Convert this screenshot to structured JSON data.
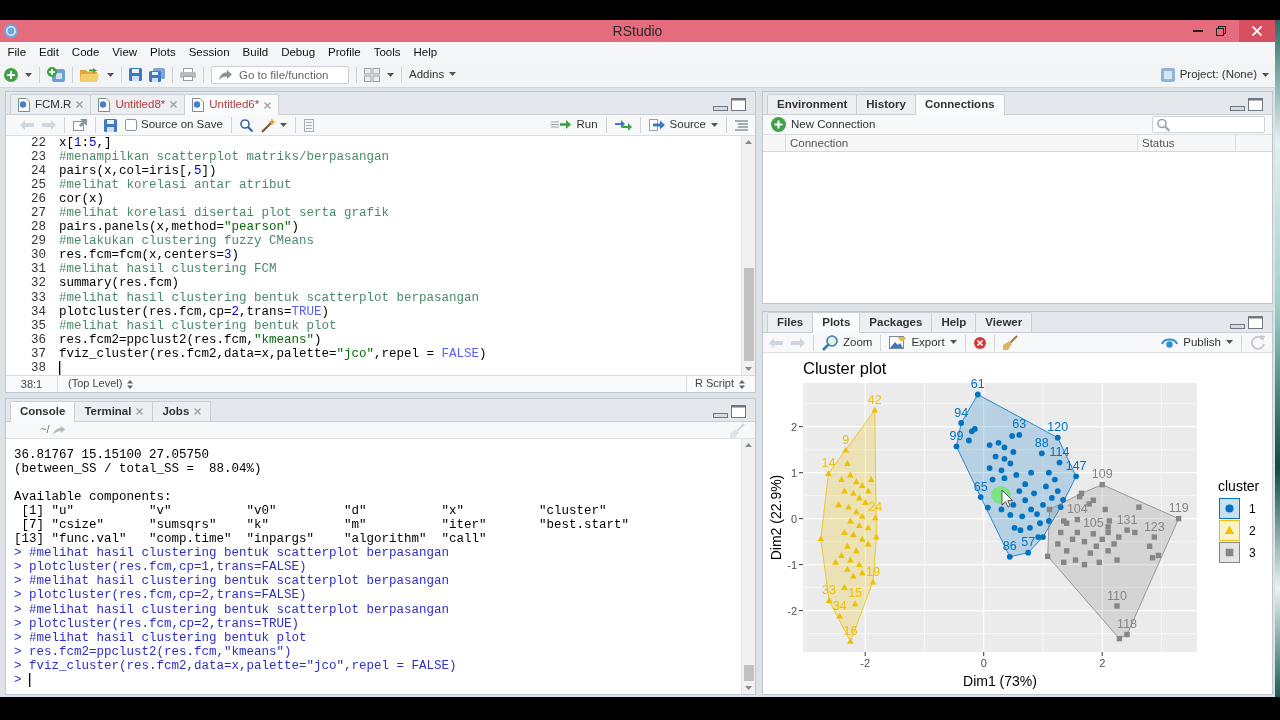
{
  "window": {
    "title": "RStudio"
  },
  "menu": [
    "File",
    "Edit",
    "Code",
    "View",
    "Plots",
    "Session",
    "Build",
    "Debug",
    "Profile",
    "Tools",
    "Help"
  ],
  "toolbar": {
    "go_to_placeholder": "Go to file/function",
    "addins": "Addins",
    "project": "Project: (None)"
  },
  "source": {
    "tabs": [
      {
        "label": "FCM.R",
        "modified": false,
        "closable": true,
        "selected": false
      },
      {
        "label": "Untitled8*",
        "modified": true,
        "closable": true,
        "selected": false
      },
      {
        "label": "Untitled6*",
        "modified": true,
        "closable": true,
        "selected": true
      }
    ],
    "history_disabled": true,
    "source_on_save": {
      "label": "Source on Save",
      "checked": false
    },
    "run": "Run",
    "source": "Source",
    "lines": [
      {
        "number": "22",
        "caret": false,
        "tokens": [
          {
            "kind": "plain",
            "text": "x["
          },
          {
            "kind": "number",
            "text": "1"
          },
          {
            "kind": "plain",
            "text": ":"
          },
          {
            "kind": "number",
            "text": "5"
          },
          {
            "kind": "plain",
            "text": ",]"
          }
        ]
      },
      {
        "number": "23",
        "caret": false,
        "tokens": [
          {
            "kind": "comment",
            "text": "#menampilkan scatterplot matriks/berpasangan"
          }
        ]
      },
      {
        "number": "24",
        "caret": false,
        "tokens": [
          {
            "kind": "plain",
            "text": "pairs(x,col=iris[,"
          },
          {
            "kind": "number",
            "text": "5"
          },
          {
            "kind": "plain",
            "text": "])"
          }
        ]
      },
      {
        "number": "25",
        "caret": false,
        "tokens": [
          {
            "kind": "comment",
            "text": "#melihat korelasi antar atribut"
          }
        ]
      },
      {
        "number": "26",
        "caret": false,
        "tokens": [
          {
            "kind": "plain",
            "text": "cor(x)"
          }
        ]
      },
      {
        "number": "27",
        "caret": false,
        "tokens": [
          {
            "kind": "comment",
            "text": "#melihat korelasi disertai plot serta grafik"
          }
        ]
      },
      {
        "number": "28",
        "caret": false,
        "tokens": [
          {
            "kind": "plain",
            "text": "pairs.panels(x,method="
          },
          {
            "kind": "string",
            "text": "\"pearson\""
          },
          {
            "kind": "plain",
            "text": ")"
          }
        ]
      },
      {
        "number": "29",
        "caret": false,
        "tokens": [
          {
            "kind": "comment",
            "text": "#melakukan clustering fuzzy CMeans"
          }
        ]
      },
      {
        "number": "30",
        "caret": false,
        "tokens": [
          {
            "kind": "plain",
            "text": "res.fcm=fcm(x,centers="
          },
          {
            "kind": "number",
            "text": "3"
          },
          {
            "kind": "plain",
            "text": ")"
          }
        ]
      },
      {
        "number": "31",
        "caret": false,
        "tokens": [
          {
            "kind": "comment",
            "text": "#melihat hasil clustering FCM"
          }
        ]
      },
      {
        "number": "32",
        "caret": false,
        "tokens": [
          {
            "kind": "plain",
            "text": "summary(res.fcm)"
          }
        ]
      },
      {
        "number": "33",
        "caret": false,
        "tokens": [
          {
            "kind": "comment",
            "text": "#melihat hasil clustering bentuk scatterplot berpasangan"
          }
        ]
      },
      {
        "number": "34",
        "caret": false,
        "tokens": [
          {
            "kind": "plain",
            "text": "plotcluster(res.fcm,cp="
          },
          {
            "kind": "number",
            "text": "2"
          },
          {
            "kind": "plain",
            "text": ",trans="
          },
          {
            "kind": "constant",
            "text": "TRUE"
          },
          {
            "kind": "plain",
            "text": ")"
          }
        ]
      },
      {
        "number": "35",
        "caret": false,
        "tokens": [
          {
            "kind": "comment",
            "text": "#melihat hasil clustering bentuk plot"
          }
        ]
      },
      {
        "number": "36",
        "caret": false,
        "tokens": [
          {
            "kind": "plain",
            "text": "res.fcm2=ppclust2(res.fcm,"
          },
          {
            "kind": "string",
            "text": "\"kmeans\""
          },
          {
            "kind": "plain",
            "text": ")"
          }
        ]
      },
      {
        "number": "37",
        "caret": false,
        "tokens": [
          {
            "kind": "plain",
            "text": "fviz_cluster(res.fcm2,data=x,palette="
          },
          {
            "kind": "string",
            "text": "\"jco\""
          },
          {
            "kind": "plain",
            "text": ",repel = "
          },
          {
            "kind": "constant",
            "text": "FALSE"
          },
          {
            "kind": "plain",
            "text": ")"
          }
        ]
      },
      {
        "number": "38",
        "caret": true
      }
    ],
    "status": {
      "position": "38:1",
      "scope": "(Top Level)",
      "file_type": "R Script"
    }
  },
  "console": {
    "tabs": [
      {
        "label": "Console",
        "closable": false,
        "selected": true
      },
      {
        "label": "Terminal",
        "closable": true,
        "selected": false
      },
      {
        "label": "Jobs",
        "closable": true,
        "selected": false
      }
    ],
    "path": "~/",
    "lines": [
      {
        "kind": "output",
        "text": "36.81767 15.15100 27.05750"
      },
      {
        "kind": "output",
        "text": "(between_SS / total_SS =  88.04%)"
      },
      {
        "kind": "blank"
      },
      {
        "kind": "output",
        "text": "Available components:"
      },
      {
        "kind": "output",
        "text": " [1] \"u\"          \"v\"          \"v0\"         \"d\"          \"x\"          \"cluster\""
      },
      {
        "kind": "output",
        "text": " [7] \"csize\"      \"sumsqrs\"    \"k\"          \"m\"          \"iter\"       \"best.start\""
      },
      {
        "kind": "output",
        "text": "[13] \"func.val\"   \"comp.time\"  \"inpargs\"    \"algorithm\"  \"call\""
      },
      {
        "kind": "input",
        "text": "> #melihat hasil clustering bentuk scatterplot berpasangan"
      },
      {
        "kind": "input",
        "text": "> plotcluster(res.fcm,cp=1,trans=FALSE)"
      },
      {
        "kind": "input",
        "text": "> #melihat hasil clustering bentuk scatterplot berpasangan"
      },
      {
        "kind": "input",
        "text": "> plotcluster(res.fcm,cp=2,trans=FALSE)"
      },
      {
        "kind": "input",
        "text": "> #melihat hasil clustering bentuk scatterplot berpasangan"
      },
      {
        "kind": "input",
        "text": "> plotcluster(res.fcm,cp=2,trans=TRUE)"
      },
      {
        "kind": "input",
        "text": "> #melihat hasil clustering bentuk plot"
      },
      {
        "kind": "input",
        "text": "> res.fcm2=ppclust2(res.fcm,\"kmeans\")"
      },
      {
        "kind": "input",
        "text": "> fviz_cluster(res.fcm2,data=x,palette=\"jco\",repel = FALSE)"
      }
    ],
    "prompt": {
      "text": ">",
      "caret": true
    }
  },
  "environment": {
    "tabs": [
      {
        "label": "Environment",
        "selected": false
      },
      {
        "label": "History",
        "selected": false
      },
      {
        "label": "Connections",
        "selected": true
      }
    ],
    "new_connection": "New Connection",
    "columns": [
      "Connection",
      "Status"
    ]
  },
  "plots": {
    "tabs": [
      {
        "label": "Files",
        "selected": false
      },
      {
        "label": "Plots",
        "selected": true
      },
      {
        "label": "Packages",
        "selected": false
      },
      {
        "label": "Help",
        "selected": false
      },
      {
        "label": "Viewer",
        "selected": false
      }
    ],
    "history_disabled": true,
    "zoom": "Zoom",
    "export": "Export",
    "publish": "Publish",
    "chart_data": {
      "type": "scatter",
      "title": "Cluster plot",
      "xlabel": "Dim1 (73%)",
      "ylabel": "Dim2 (22.9%)",
      "xlim": [
        -3.05,
        3.6
      ],
      "ylim": [
        -2.9,
        2.95
      ],
      "xticks": [
        {
          "value": -2,
          "label": "-2"
        },
        {
          "value": 0,
          "label": "0"
        },
        {
          "value": 2,
          "label": "2"
        }
      ],
      "yticks": [
        {
          "value": -2,
          "label": "-2"
        },
        {
          "value": -1,
          "label": "-1"
        },
        {
          "value": 0,
          "label": "0"
        },
        {
          "value": 1,
          "label": "1"
        },
        {
          "value": 2,
          "label": "2"
        }
      ],
      "grid": true,
      "legend": {
        "title": "cluster"
      },
      "series": [
        {
          "name": "1",
          "color": "#0073c2",
          "x": [
            -0.1,
            1.25,
            1.56,
            1.34,
            0.75,
            0.44,
            0.07,
            -0.46,
            -0.38,
            -0.15,
            0.48,
            0.6,
            0.1,
            0.25,
            0.2,
            0.35,
            0.1,
            0.3,
            0.45,
            0.15,
            0.35,
            0.55,
            0.7,
            0.85,
            0.6,
            0.7,
            0.5,
            0.8,
            0.65,
            0.9,
            1.0,
            0.95,
            0.78,
            0.92,
            0.98,
            1.28,
            1.1,
            1.2,
            1.05,
            1.25,
            1.15,
            1.3,
            1.1,
            0.52,
            0.62,
            1.0,
            0.3,
            -0.05,
            -0.2,
            -0.25,
            0.5,
            0.35,
            0.45,
            0.8
          ],
          "values": [
            2.7,
            1.76,
            0.92,
            0.41,
            -0.74,
            -0.83,
            0.24,
            1.57,
            2.08,
            1.95,
            1.8,
            1.82,
            1.6,
            1.65,
            1.35,
            1.3,
            1.1,
            1.05,
            1.2,
            0.85,
            0.88,
            0.95,
            0.75,
            0.55,
            0.6,
            0.4,
            0.3,
            0.2,
            0.05,
            0.1,
            0.3,
            -0.1,
            -0.2,
            -0.4,
            1.42,
            1.22,
            1.0,
            0.85,
            0.7,
            0.6,
            0.45,
            0.25,
            -0.05,
            -0.2,
            -0.25,
            -0.4,
            0.2,
            0.47,
            1.9,
            1.7,
            1.45,
            1.55,
            0.08,
            1.0
          ]
        },
        {
          "name": "2",
          "color": "#efc000",
          "x": [
            -1.84,
            -2.33,
            -2.62,
            -2.75,
            -2.61,
            -2.43,
            -2.25,
            -1.87,
            -1.81,
            -1.9,
            -1.83,
            -2.17,
            -2.4,
            -2.3,
            -2.25,
            -2.15,
            -2.05,
            -2.35,
            -2.2,
            -2.1,
            -2.0,
            -2.28,
            -2.15,
            -2.05,
            -2.25,
            -2.1,
            -1.95,
            -2.35,
            -2.2,
            -2.05,
            -1.95,
            -2.3,
            -2.15,
            -2.4,
            -2.25,
            -2.1,
            -2.3,
            -2.2,
            -2.05,
            -2.35,
            -2.5,
            -1.95,
            -2.45
          ],
          "values": [
            2.36,
            1.49,
            0.98,
            -0.44,
            -1.78,
            -2.12,
            -2.67,
            -1.38,
            -0.4,
            0.85,
            0.02,
            -1.85,
            0.85,
            1.2,
            0.95,
            0.8,
            0.72,
            0.6,
            0.55,
            0.45,
            0.35,
            0.25,
            0.15,
            0.05,
            -0.05,
            -0.15,
            -0.2,
            -0.3,
            -0.35,
            -0.45,
            -0.55,
            -0.6,
            -0.7,
            -0.8,
            -0.9,
            -1.0,
            -1.1,
            -1.25,
            -1.18,
            -1.5,
            -0.95,
            0.6,
            0.3
          ]
        },
        {
          "name": "3",
          "color": "#868686",
          "x": [
            2.0,
            3.29,
            2.42,
            2.29,
            1.08,
            1.11,
            1.35,
            1.4,
            1.58,
            1.3,
            1.5,
            1.25,
            1.7,
            1.85,
            1.9,
            2.0,
            2.1,
            2.1,
            2.2,
            2.28,
            2.42,
            2.55,
            2.1,
            1.8,
            1.55,
            1.35,
            1.95,
            2.25,
            2.88,
            2.8,
            2.95,
            2.85,
            2.25,
            1.65,
            1.85,
            1.78,
            2.05,
            1.62,
            2.62,
            2.12,
            1.4,
            1.7,
            1.58
          ],
          "values": [
            0.74,
            0.0,
            -2.52,
            -2.61,
            -0.82,
            0.2,
            -0.05,
            -0.1,
            -0.3,
            -0.3,
            -0.45,
            -0.55,
            -0.5,
            -0.33,
            -0.6,
            -0.45,
            -0.3,
            -0.18,
            -0.55,
            -0.4,
            -0.25,
            -0.3,
            -0.7,
            -0.75,
            -0.9,
            -0.95,
            -0.95,
            -0.9,
            -0.4,
            -0.6,
            -0.8,
            -0.85,
            -1.9,
            0.55,
            0.4,
            0.32,
            0.2,
            0.48,
            0.25,
            -0.05,
            -0.7,
            -1.0,
            -0.02
          ]
        }
      ],
      "annotations": [
        {
          "x": -0.1,
          "y": 2.7,
          "text": "61"
        },
        {
          "x": -0.38,
          "y": 2.08,
          "text": "94"
        },
        {
          "x": -0.46,
          "y": 1.57,
          "text": "99"
        },
        {
          "x": 0.6,
          "y": 1.82,
          "text": "63"
        },
        {
          "x": 1.25,
          "y": 1.76,
          "text": "120"
        },
        {
          "x": 0.98,
          "y": 1.42,
          "text": "88"
        },
        {
          "x": 1.28,
          "y": 1.22,
          "text": "114"
        },
        {
          "x": 1.56,
          "y": 0.92,
          "text": "147"
        },
        {
          "x": -0.05,
          "y": 0.47,
          "text": "65"
        },
        {
          "x": 0.44,
          "y": -0.83,
          "text": "86"
        },
        {
          "x": 0.75,
          "y": -0.74,
          "text": "57"
        },
        {
          "x": -1.84,
          "y": 2.36,
          "text": "42"
        },
        {
          "x": -2.33,
          "y": 1.49,
          "text": "9"
        },
        {
          "x": -2.62,
          "y": 0.98,
          "text": "14"
        },
        {
          "x": -1.83,
          "y": 0.02,
          "text": "24"
        },
        {
          "x": -1.87,
          "y": -1.38,
          "text": "19"
        },
        {
          "x": -2.61,
          "y": -1.78,
          "text": "33"
        },
        {
          "x": -2.17,
          "y": -1.85,
          "text": "15"
        },
        {
          "x": -2.43,
          "y": -2.12,
          "text": "34"
        },
        {
          "x": -2.25,
          "y": -2.67,
          "text": "16"
        },
        {
          "x": 2.0,
          "y": 0.74,
          "text": "109"
        },
        {
          "x": 3.29,
          "y": 0.0,
          "text": "119"
        },
        {
          "x": 1.58,
          "y": -0.02,
          "text": "104"
        },
        {
          "x": 1.85,
          "y": -0.33,
          "text": "105"
        },
        {
          "x": 2.42,
          "y": -0.25,
          "text": "131"
        },
        {
          "x": 2.88,
          "y": -0.4,
          "text": "123"
        },
        {
          "x": 2.25,
          "y": -1.9,
          "text": "110"
        },
        {
          "x": 2.42,
          "y": -2.52,
          "text": "118"
        }
      ]
    }
  }
}
